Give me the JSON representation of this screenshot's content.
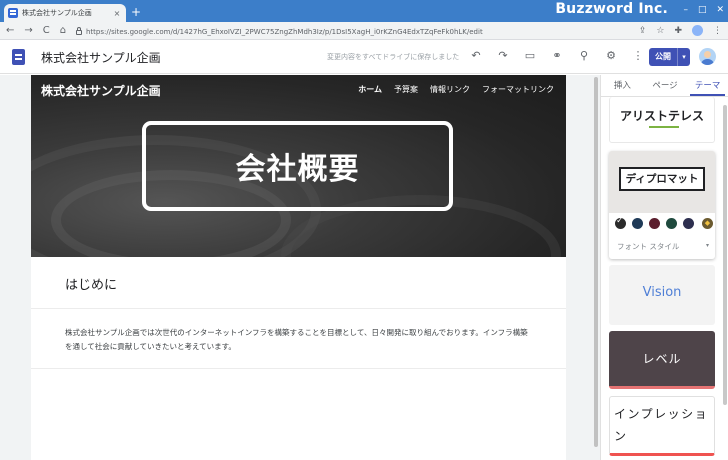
{
  "browser": {
    "tab_title": "株式会社サンプル企画",
    "tab_close": "×",
    "new_tab": "+",
    "brand_overlay": "Buzzword Inc.",
    "url": "https://sites.google.com/d/1427hG_EhxoIVZI_2PWC75ZngZhMdh3Iz/p/1DsI5XagH_i0rKZnG4EdxTZqFeFk0hLK/edit",
    "nav": {
      "back": "←",
      "forward": "→",
      "reload": "C",
      "home": "⌂"
    },
    "right_icons": {
      "share": "⇪",
      "star": "☆",
      "extension": "✚",
      "menu": "⋮"
    },
    "window": {
      "minimize": "–",
      "maximize": "□",
      "close": "✕"
    }
  },
  "editor": {
    "site_title": "株式会社サンプル企画",
    "save_status": "変更内容をすべてドライブに保存しました",
    "toolbar": {
      "undo": "↶",
      "redo": "↷",
      "preview": "▭",
      "link": "⚭",
      "share": "⚲",
      "settings": "⚙",
      "more": "⋮"
    },
    "publish_label": "公開",
    "publish_caret": "▾"
  },
  "site": {
    "brand": "株式会社サンプル企画",
    "nav": [
      "ホーム",
      "予算案",
      "情報リンク",
      "フォーマットリンク"
    ],
    "active_nav": "ホーム",
    "hero_title": "会社概要",
    "section_heading": "はじめに",
    "section_body": "株式会社サンプル企画では次世代のインターネットインフラを構築することを目標として、日々開発に取り組んでおります。インフラ構築を通して社会に貢献していきたいと考えています。"
  },
  "panel": {
    "tabs": [
      "挿入",
      "ページ",
      "テーマ"
    ],
    "active_tab": "テーマ",
    "themes": {
      "aristotle": "アリストテレス",
      "diplomat": "ディプロマット",
      "vision": "Vision",
      "level": "レベル",
      "impression": "インプレッション"
    },
    "diplomat_swatches": [
      "#2b2b2b",
      "#1f3a57",
      "#5b1e2d",
      "#1f4a3e",
      "#2d2f4f"
    ],
    "font_style_label": "フォント スタイル",
    "font_style_caret": "▾"
  }
}
